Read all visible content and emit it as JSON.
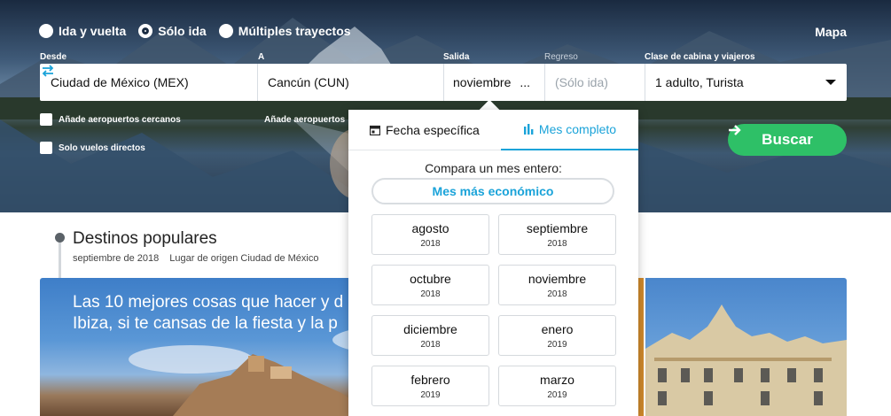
{
  "trip_types": [
    {
      "label": "Ida y vuelta",
      "selected": false
    },
    {
      "label": "Sólo ida",
      "selected": true
    },
    {
      "label": "Múltiples trayectos",
      "selected": false
    }
  ],
  "map_link": "Mapa",
  "labels": {
    "from": "Desde",
    "to": "A",
    "departure": "Salida",
    "return": "Regreso",
    "cabin": "Clase de cabina y viajeros"
  },
  "fields": {
    "from_value": "Ciudad de México (MEX)",
    "to_value": "Cancún (CUN)",
    "departure_value": "noviembre",
    "departure_ellipsis": "...",
    "return_value": "(Sólo ida)",
    "cabin_value": "1 adulto, Turista"
  },
  "checkboxes": {
    "nearby_from": "Añade aeropuertos cercanos",
    "nearby_to": "Añade aeropuertos cercanos",
    "direct_only": "Solo vuelos directos"
  },
  "search_button": "Buscar",
  "popular": {
    "title": "Destinos populares",
    "date": "septiembre de 2018",
    "origin": "Lugar de origen Ciudad de México"
  },
  "card": {
    "title": "Las 10 mejores cosas que hacer y d\nIbiza, si te cansas de la fiesta y la p"
  },
  "calendar": {
    "tab_specific": "Fecha específica",
    "tab_month": "Mes completo",
    "active_tab": "Mes completo",
    "compare_text": "Compara un mes entero:",
    "cheapest_label": "Mes más económico",
    "months": [
      {
        "month": "agosto",
        "year": "2018"
      },
      {
        "month": "septiembre",
        "year": "2018"
      },
      {
        "month": "octubre",
        "year": "2018"
      },
      {
        "month": "noviembre",
        "year": "2018"
      },
      {
        "month": "diciembre",
        "year": "2018"
      },
      {
        "month": "enero",
        "year": "2019"
      },
      {
        "month": "febrero",
        "year": "2019"
      },
      {
        "month": "marzo",
        "year": "2019"
      }
    ]
  },
  "colors": {
    "accent": "#1aa3d9",
    "search_green": "#2ec067"
  }
}
